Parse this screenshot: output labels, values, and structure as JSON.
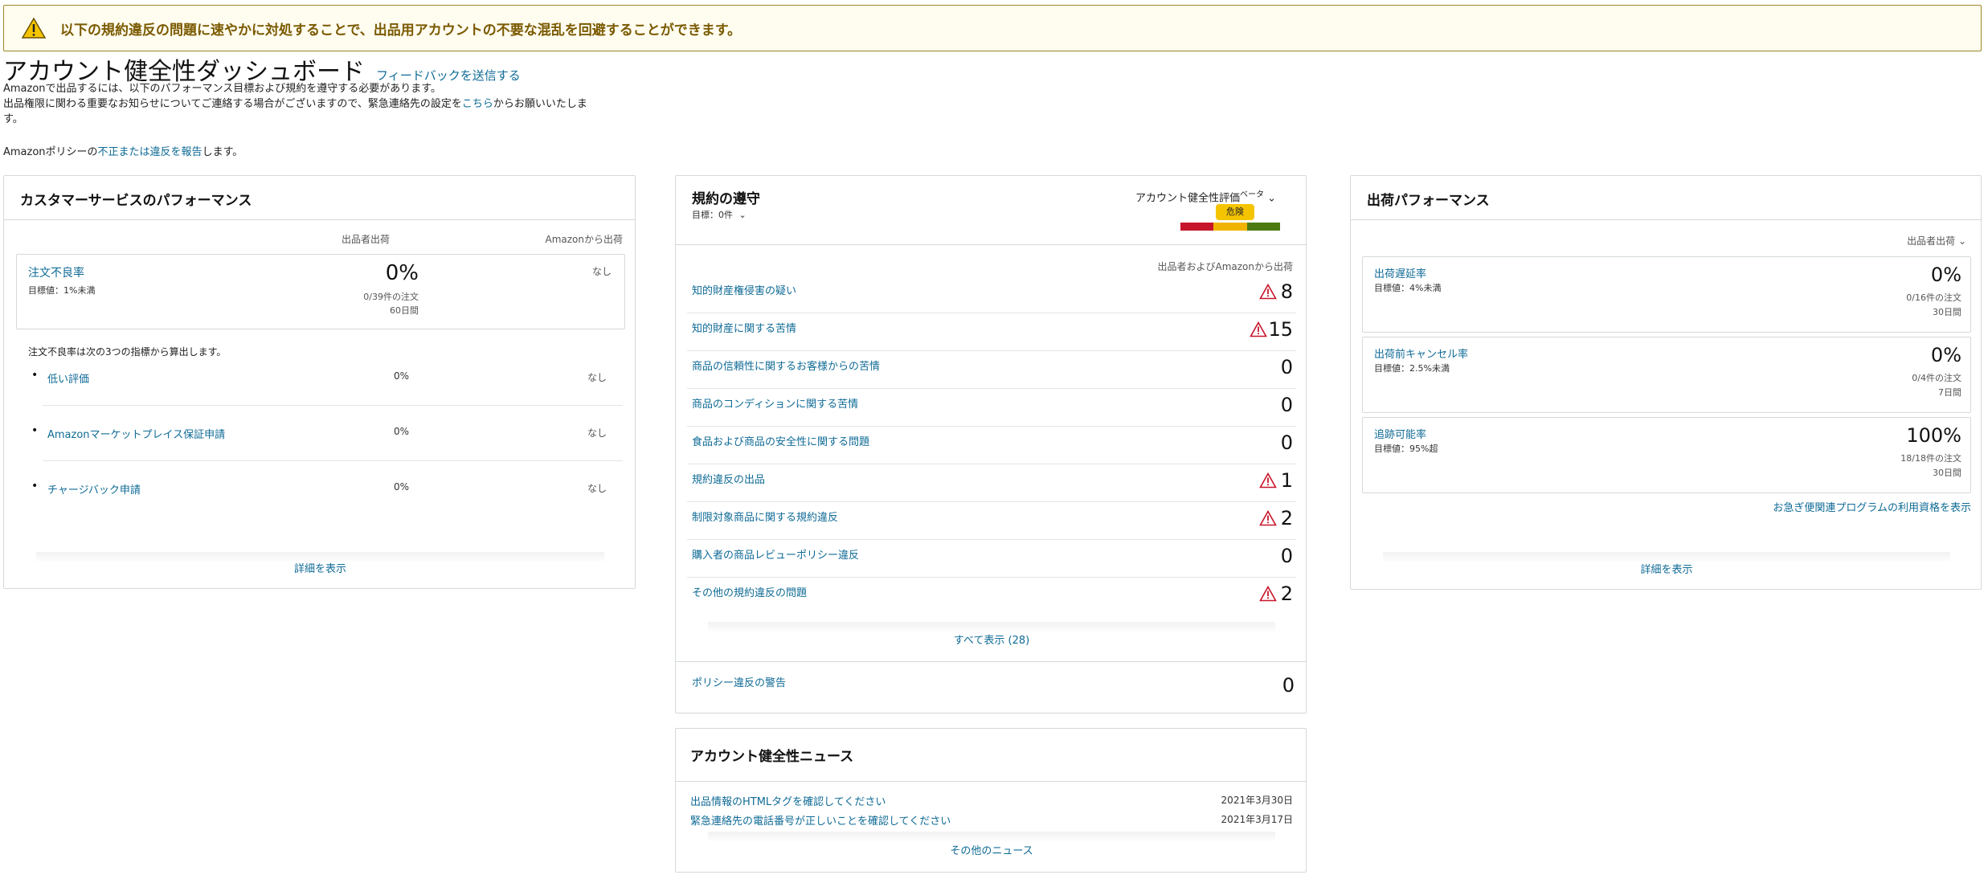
{
  "alert": {
    "icon": "warning-icon",
    "message": "以下の規約違反の問題に速やかに対処することで、出品用アカウントの不要な混乱を回避することができます。"
  },
  "header": {
    "title": "アカウント健全性ダッシュボード",
    "feedback_link": "フィードバックを送信する",
    "intro1": "Amazonで出品するには、以下のパフォーマンス目標および規約を遵守する必要があります。",
    "intro2a": "出品権限に関わる重要なお知らせについてご連絡する場合がございますので、緊急連絡先の設定を",
    "intro2_link": "こちら",
    "intro2b": "からお願いいたしま",
    "intro2c": "す。",
    "report_pre": "Amazonポリシーの",
    "report_link": "不正または違反を報告",
    "report_post": "します。"
  },
  "customer_service": {
    "title": "カスタマーサービスのパフォーマンス",
    "col_seller": "出品者出荷",
    "col_amazon": "Amazonから出荷",
    "odr": {
      "label": "注文不良率",
      "target": "目標値：1%未満",
      "value": "0%",
      "detail": "0/39件の注文",
      "period": "60日間",
      "amazon": "なし"
    },
    "note": "注文不良率は次の3つの指標から算出します。",
    "metrics": [
      {
        "label": "低い評価",
        "value": "0%",
        "amazon": "なし"
      },
      {
        "label": "Amazonマーケットプレイス保証申請",
        "value": "0%",
        "amazon": "なし"
      },
      {
        "label": "チャージバック申請",
        "value": "0%",
        "amazon": "なし"
      }
    ],
    "details_link": "詳細を表示"
  },
  "compliance": {
    "title": "規約の遵守",
    "target_label": "目標：",
    "target_value": "0件",
    "rating_label": "アカウント健全性評価",
    "beta": "ベータ",
    "rating_badge": "危険",
    "gauge_colors": [
      "#c7162b",
      "#f0b400",
      "#4c7a12"
    ],
    "col_header": "出品者およびAmazonから出荷",
    "rows": [
      {
        "label": "知的財産権侵害の疑い",
        "value": "8",
        "warn": true
      },
      {
        "label": "知的財産に関する苦情",
        "value": "15",
        "warn": true
      },
      {
        "label": "商品の信頼性に関するお客様からの苦情",
        "value": "0",
        "warn": false
      },
      {
        "label": "商品のコンディションに関する苦情",
        "value": "0",
        "warn": false
      },
      {
        "label": "食品および商品の安全性に関する問題",
        "value": "0",
        "warn": false
      },
      {
        "label": "規約違反の出品",
        "value": "1",
        "warn": true
      },
      {
        "label": "制限対象商品に関する規約違反",
        "value": "2",
        "warn": true
      },
      {
        "label": "購入者の商品レビューポリシー違反",
        "value": "0",
        "warn": false
      },
      {
        "label": "その他の規約違反の問題",
        "value": "2",
        "warn": true
      }
    ],
    "show_all": "すべて表示 (28)",
    "policy_warning": {
      "label": "ポリシー違反の警告",
      "value": "0"
    }
  },
  "news": {
    "title": "アカウント健全性ニュース",
    "items": [
      {
        "label": "出品情報のHTMLタグを確認してください",
        "date": "2021年3月30日"
      },
      {
        "label": "緊急連絡先の電話番号が正しいことを確認してください",
        "date": "2021年3月17日"
      }
    ],
    "more": "その他のニュース"
  },
  "shipping": {
    "title": "出荷パフォーマンス",
    "filter": "出品者出荷",
    "metrics": [
      {
        "label": "出荷遅延率",
        "target": "目標値：4%未満",
        "value": "0%",
        "detail": "0/16件の注文",
        "period": "30日間"
      },
      {
        "label": "出荷前キャンセル率",
        "target": "目標値：2.5%未満",
        "value": "0%",
        "detail": "0/4件の注文",
        "period": "7日間"
      },
      {
        "label": "追跡可能率",
        "target": "目標値：95%超",
        "value": "100%",
        "detail": "18/18件の注文",
        "period": "30日間"
      }
    ],
    "eligibility_link": "お急ぎ便関連プログラムの利用資格を表示",
    "details_link": "詳細を表示"
  }
}
